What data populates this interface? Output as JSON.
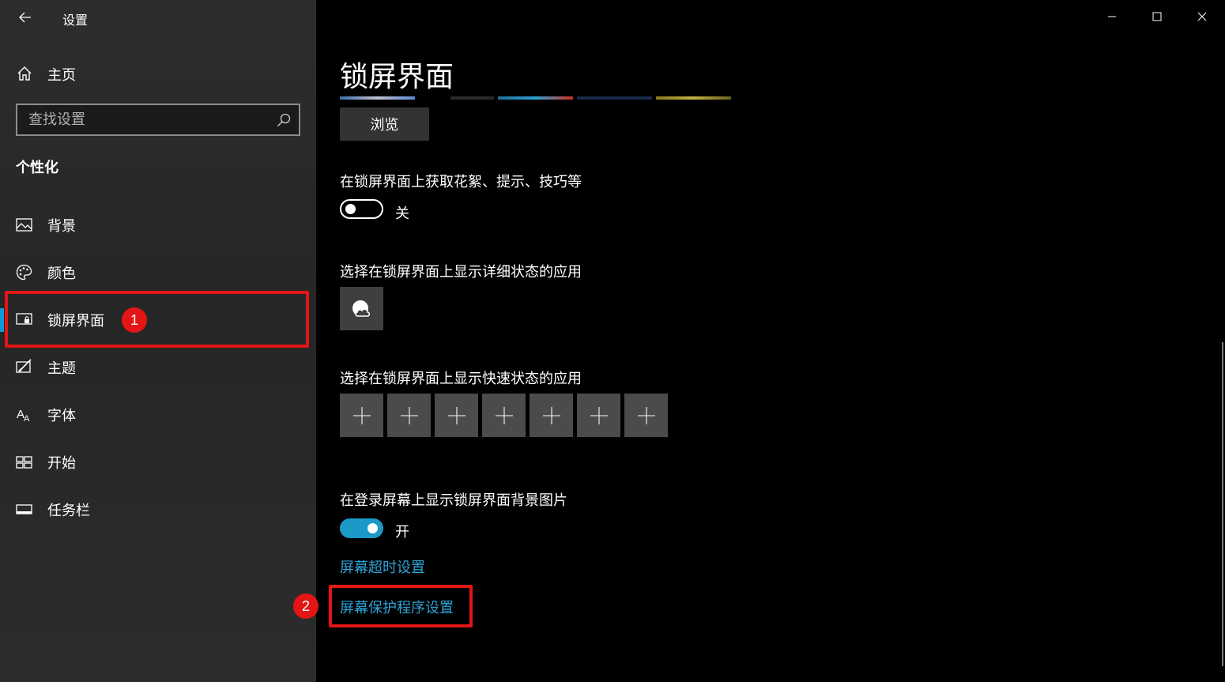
{
  "app": {
    "title": "设置"
  },
  "sidebar": {
    "home_label": "主页",
    "search_placeholder": "查找设置",
    "section_title": "个性化",
    "items": [
      {
        "label": "背景",
        "icon": "picture-icon"
      },
      {
        "label": "颜色",
        "icon": "palette-icon"
      },
      {
        "label": "锁屏界面",
        "icon": "lock-screen-icon",
        "selected": true
      },
      {
        "label": "主题",
        "icon": "theme-icon"
      },
      {
        "label": "字体",
        "icon": "font-icon"
      },
      {
        "label": "开始",
        "icon": "start-icon"
      },
      {
        "label": "任务栏",
        "icon": "taskbar-icon"
      }
    ]
  },
  "main": {
    "page_title": "锁屏界面",
    "browse_label": "浏览",
    "fun_facts": {
      "label": "在锁屏界面上获取花絮、提示、技巧等",
      "state": "关",
      "enabled": false
    },
    "detailed_status": {
      "label": "选择在锁屏界面上显示详细状态的应用",
      "app_icon": "weather-icon"
    },
    "quick_status": {
      "label": "选择在锁屏界面上显示快速状态的应用",
      "slots": 7,
      "slot_glyph": "+"
    },
    "signin_background": {
      "label": "在登录屏幕上显示锁屏界面背景图片",
      "state": "开",
      "enabled": true
    },
    "links": {
      "screen_timeout": "屏幕超时设置",
      "screen_saver": "屏幕保护程序设置"
    }
  },
  "annotations": {
    "badge1": "1",
    "badge2": "2"
  },
  "colors": {
    "accent": "#0e9ad6",
    "link": "#2ea3d6",
    "toggle_on": "#1c99c7",
    "annotation": "#e41515"
  }
}
